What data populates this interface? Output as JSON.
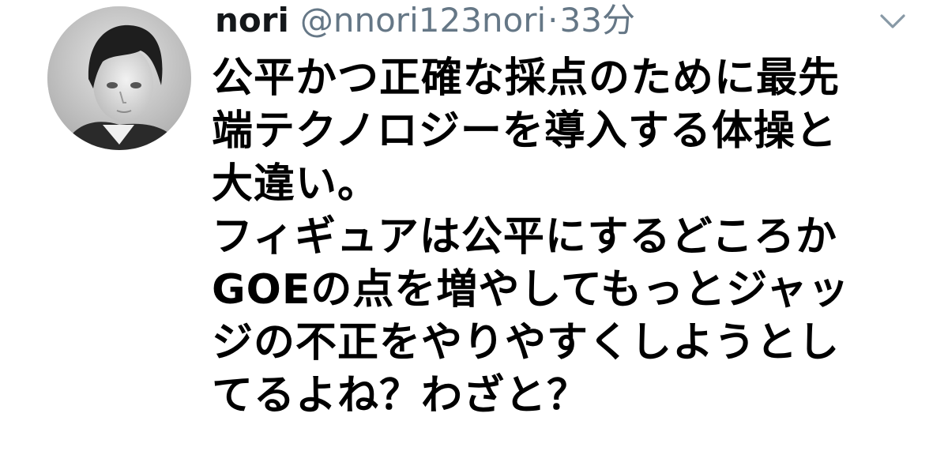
{
  "tweet": {
    "author_name": "nori",
    "author_handle": "@nnori123nori",
    "separator": "·",
    "timestamp": "33分",
    "body_lines": [
      "公平かつ正確な採点のために最先",
      "端テクノロジーを導入する体操と",
      "大違い。",
      "フィギュアは公平にするどころか",
      "GOEの点を増やしてもっとジャッ",
      "ジの不正をやりやすくしようとし",
      "てるよね？わざと？"
    ]
  },
  "icons": {
    "caret": "chevron-down-icon",
    "avatar": "avatar"
  },
  "colors": {
    "name": "#14171a",
    "secondary": "#657786",
    "text": "#000000",
    "background": "#ffffff"
  }
}
